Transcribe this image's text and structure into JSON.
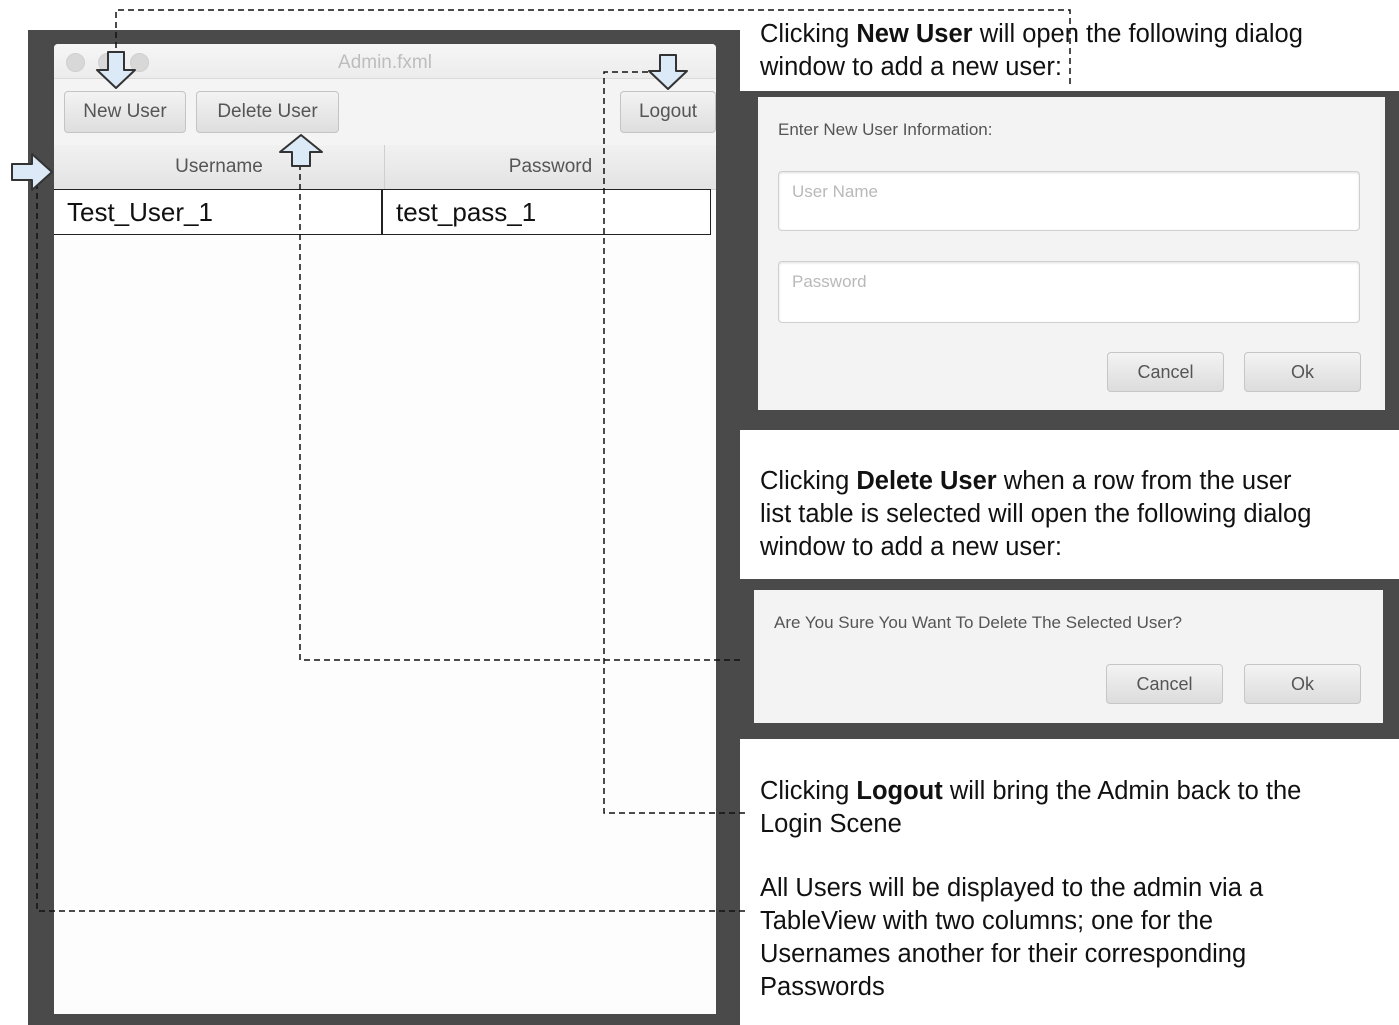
{
  "admin_window": {
    "title": "Admin.fxml",
    "new_user_label": "New User",
    "delete_user_label": "Delete User",
    "logout_label": "Logout",
    "columns": [
      "Username",
      "Password"
    ],
    "rows": [
      [
        "Test_User_1",
        "test_pass_1"
      ]
    ]
  },
  "new_user_section": {
    "desc_pre": "Clicking ",
    "desc_bold": "New User",
    "desc_post1": " will open the following dialog",
    "desc_post2": "window to add a new user:",
    "dialog": {
      "header": "Enter New User Information:",
      "username_placeholder": "User Name",
      "password_placeholder": "Password",
      "cancel_label": "Cancel",
      "ok_label": "Ok"
    }
  },
  "delete_user_section": {
    "desc_pre": "Clicking ",
    "desc_bold": "Delete User",
    "desc_post1": " when a row from the user",
    "desc_line2": "list table is selected will open the following dialog",
    "desc_line3": "window to add a new user:",
    "dialog": {
      "message": "Are You Sure You Want To Delete The Selected User?",
      "cancel_label": "Cancel",
      "ok_label": "Ok"
    }
  },
  "logout_section": {
    "desc_pre": "Clicking ",
    "desc_bold": "Logout",
    "desc_post1": " will bring the Admin back to the",
    "desc_line2": "Login Scene"
  },
  "tableview_section": {
    "line1": "All Users will be displayed to the admin via a",
    "line2": "TableView with two columns; one for the",
    "line3": "Usernames another for their corresponding",
    "line4": "Passwords"
  },
  "colors": {
    "frame": "#4a4a4a",
    "arrow_fill": "#dce9f7",
    "arrow_stroke": "#333333",
    "connector": "#111111"
  }
}
